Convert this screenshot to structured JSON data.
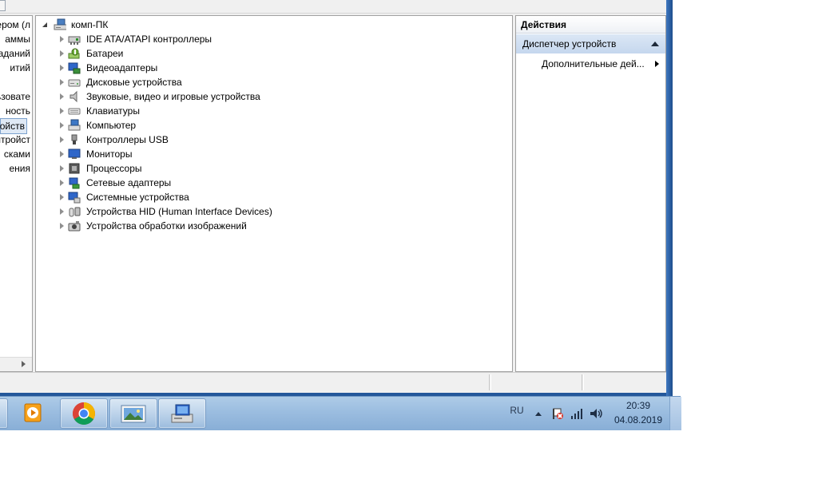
{
  "left_tree": {
    "items": [
      {
        "label": "ером (л",
        "selected": false
      },
      {
        "label": "аммы",
        "selected": false
      },
      {
        "label": "заданий",
        "selected": false
      },
      {
        "label": "итий",
        "selected": false
      },
      {
        "label": "",
        "selected": false
      },
      {
        "label": "льзовате",
        "selected": false
      },
      {
        "label": "ность",
        "selected": false
      },
      {
        "label": "ойств",
        "selected": true
      },
      {
        "label": "нтройст",
        "selected": false
      },
      {
        "label": "сками",
        "selected": false
      },
      {
        "label": "ения",
        "selected": false
      }
    ]
  },
  "device_tree": {
    "root": {
      "label": "комп-ПК",
      "icon": "computer-icon"
    },
    "items": [
      {
        "label": "IDE ATA/ATAPI контроллеры",
        "icon": "ide-controller-icon"
      },
      {
        "label": "Батареи",
        "icon": "battery-icon"
      },
      {
        "label": "Видеоадаптеры",
        "icon": "display-adapter-icon"
      },
      {
        "label": "Дисковые устройства",
        "icon": "disk-drive-icon"
      },
      {
        "label": "Звуковые, видео и игровые устройства",
        "icon": "sound-icon"
      },
      {
        "label": "Клавиатуры",
        "icon": "keyboard-icon"
      },
      {
        "label": "Компьютер",
        "icon": "computer-icon"
      },
      {
        "label": "Контроллеры USB",
        "icon": "usb-icon"
      },
      {
        "label": "Мониторы",
        "icon": "monitor-icon"
      },
      {
        "label": "Процессоры",
        "icon": "processor-icon"
      },
      {
        "label": "Сетевые адаптеры",
        "icon": "network-adapter-icon"
      },
      {
        "label": "Системные устройства",
        "icon": "system-devices-icon"
      },
      {
        "label": "Устройства HID (Human Interface Devices)",
        "icon": "hid-icon"
      },
      {
        "label": "Устройства обработки изображений",
        "icon": "imaging-device-icon"
      }
    ]
  },
  "actions": {
    "title": "Действия",
    "section": "Диспетчер устройств",
    "item": "Дополнительные дей..."
  },
  "taskbar": {
    "buttons": [
      "media-player-icon",
      "chrome-icon",
      "picture-viewer-icon",
      "device-manager-icon"
    ],
    "language": "RU",
    "time": "20:39",
    "date": "04.08.2019"
  },
  "colors": {
    "window_frame": "#2f66ad",
    "taskbar": "#9bbde0",
    "selection": "#dfe9f5",
    "actions_header": "#c5d7ee"
  }
}
